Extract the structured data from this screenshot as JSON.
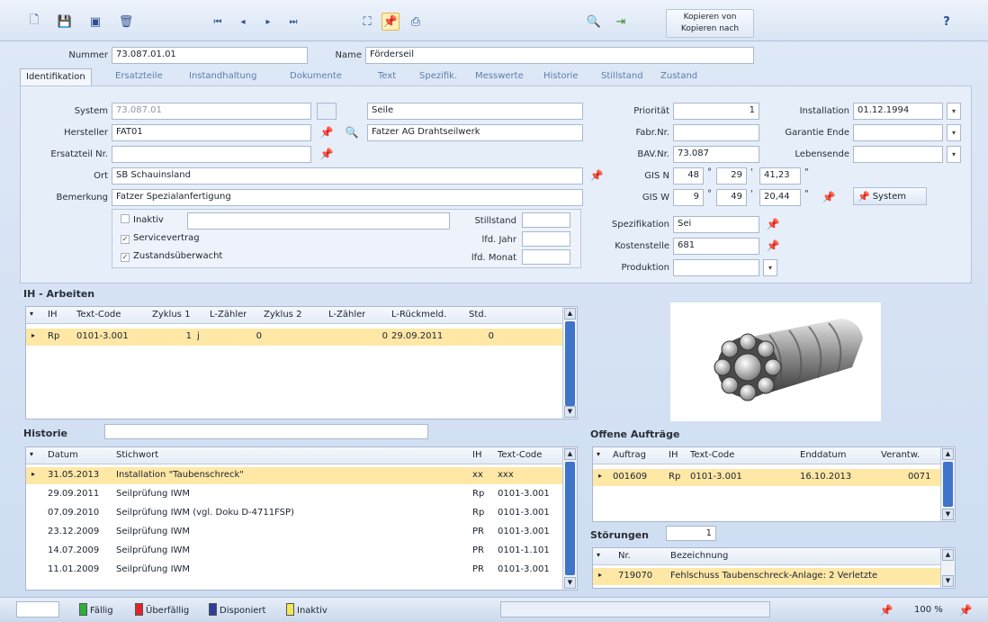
{
  "toolbar": {
    "copy_from": "Kopieren von",
    "copy_to": "Kopieren nach",
    "help": "?",
    "icons": [
      "new-icon",
      "save-icon",
      "save-close-icon",
      "delete-icon",
      "first-record-icon",
      "prev-record-icon",
      "next-record-icon",
      "last-record-icon",
      "binoculars-icon",
      "pin-icon",
      "print-icon",
      "search-key-icon",
      "exit-icon"
    ]
  },
  "header": {
    "nummer_label": "Nummer",
    "nummer": "73.087.01.01",
    "name_label": "Name",
    "name": "Förderseil"
  },
  "tabs": [
    "Identifikation",
    "Ersatzteile",
    "Instandhaltung",
    "Dokumente",
    "Text",
    "Spezifik.",
    "Messwerte",
    "Historie",
    "Stillstand",
    "Zustand"
  ],
  "ident": {
    "system_label": "System",
    "system": "73.087.01",
    "system_desc": "Seile",
    "hersteller_label": "Hersteller",
    "hersteller": "FAT01",
    "hersteller_desc": "Fatzer AG Drahtseilwerk",
    "ersatzteil_label": "Ersatzteil Nr.",
    "ersatzteil": "",
    "ort_label": "Ort",
    "ort": "SB Schauinsland",
    "bemerkung_label": "Bemerkung",
    "bemerkung": "Fatzer Spezialanfertigung",
    "prioritaet_label": "Priorität",
    "prioritaet": "1",
    "fabr_label": "Fabr.Nr.",
    "fabr": "",
    "bav_label": "BAV.Nr.",
    "bav": "73.087",
    "gisn_label": "GIS N",
    "gisn_deg": "48",
    "gisn_min": "29",
    "gisn_sec": "41,23",
    "gisw_label": "GIS W",
    "gisw_deg": "9",
    "gisw_min": "49",
    "gisw_sec": "20,44",
    "deg": "°",
    "min": "'",
    "sec": "\"",
    "system_button": "System",
    "installation_label": "Installation",
    "installation": "01.12.1994",
    "garantie_label": "Garantie Ende",
    "garantie": "",
    "lebensende_label": "Lebensende",
    "lebensende": "",
    "inaktiv": "Inaktiv",
    "servicevertrag": "Servicevertrag",
    "zustand": "Zustandsüberwacht",
    "stillstand_label": "Stillstand",
    "stillstand": "",
    "lfd_jahr_label": "lfd. Jahr",
    "lfd_jahr": "",
    "lfd_monat_label": "lfd. Monat",
    "lfd_monat": "",
    "spezifikation_label": "Spezifikation",
    "spezifikation": "Sei",
    "kostenstelle_label": "Kostenstelle",
    "kostenstelle": "681",
    "produktion_label": "Produktion",
    "produktion": ""
  },
  "ih": {
    "title": "IH - Arbeiten",
    "columns": [
      "IH",
      "Text-Code",
      "Zyklus 1",
      "L-Zähler",
      "Zyklus 2",
      "L-Zähler",
      "L-Rückmeld.",
      "Std."
    ],
    "rows": [
      [
        "Rp",
        "0101-3.001",
        "1",
        "0",
        "",
        "0",
        "29.09.2011",
        "0"
      ]
    ],
    "cycle_unit": "j"
  },
  "historie": {
    "title": "Historie",
    "filter": "",
    "columns": [
      "Datum",
      "Stichwort",
      "IH",
      "Text-Code"
    ],
    "rows": [
      [
        "31.05.2013",
        "Installation \"Taubenschreck\"",
        "xx",
        "xxx"
      ],
      [
        "29.09.2011",
        "Seilprüfung IWM",
        "Rp",
        "0101-3.001"
      ],
      [
        "07.09.2010",
        "Seilprüfung IWM (vgl. Doku D-4711FSP)",
        "Rp",
        "0101-3.001"
      ],
      [
        "23.12.2009",
        "Seilprüfung IWM",
        "PR",
        "0101-3.001"
      ],
      [
        "14.07.2009",
        "Seilprüfung IWM",
        "PR",
        "0101-1.101"
      ],
      [
        "11.01.2009",
        "Seilprüfung IWM",
        "PR",
        "0101-3.001"
      ]
    ]
  },
  "auftraege": {
    "title": "Offene Aufträge",
    "columns": [
      "Auftrag",
      "IH",
      "Text-Code",
      "Enddatum",
      "Verantw."
    ],
    "rows": [
      [
        "001609",
        "Rp",
        "0101-3.001",
        "16.10.2013",
        "0071"
      ]
    ]
  },
  "stoerungen": {
    "title": "Störungen",
    "count": "1",
    "columns": [
      "Nr.",
      "Bezeichnung"
    ],
    "rows": [
      [
        "719070",
        "Fehlschuss Taubenschreck-Anlage: 2 Verletzte"
      ]
    ]
  },
  "status": {
    "faellig": "Fällig",
    "ueberfaellig": "Überfällig",
    "disponiert": "Disponiert",
    "inaktiv": "Inaktiv",
    "zoom": "100 %",
    "colors": {
      "faellig": "#2fae3c",
      "ueberfaellig": "#e0242b",
      "disponiert": "#2f3c9a",
      "inaktiv": "#f2e65a"
    }
  }
}
